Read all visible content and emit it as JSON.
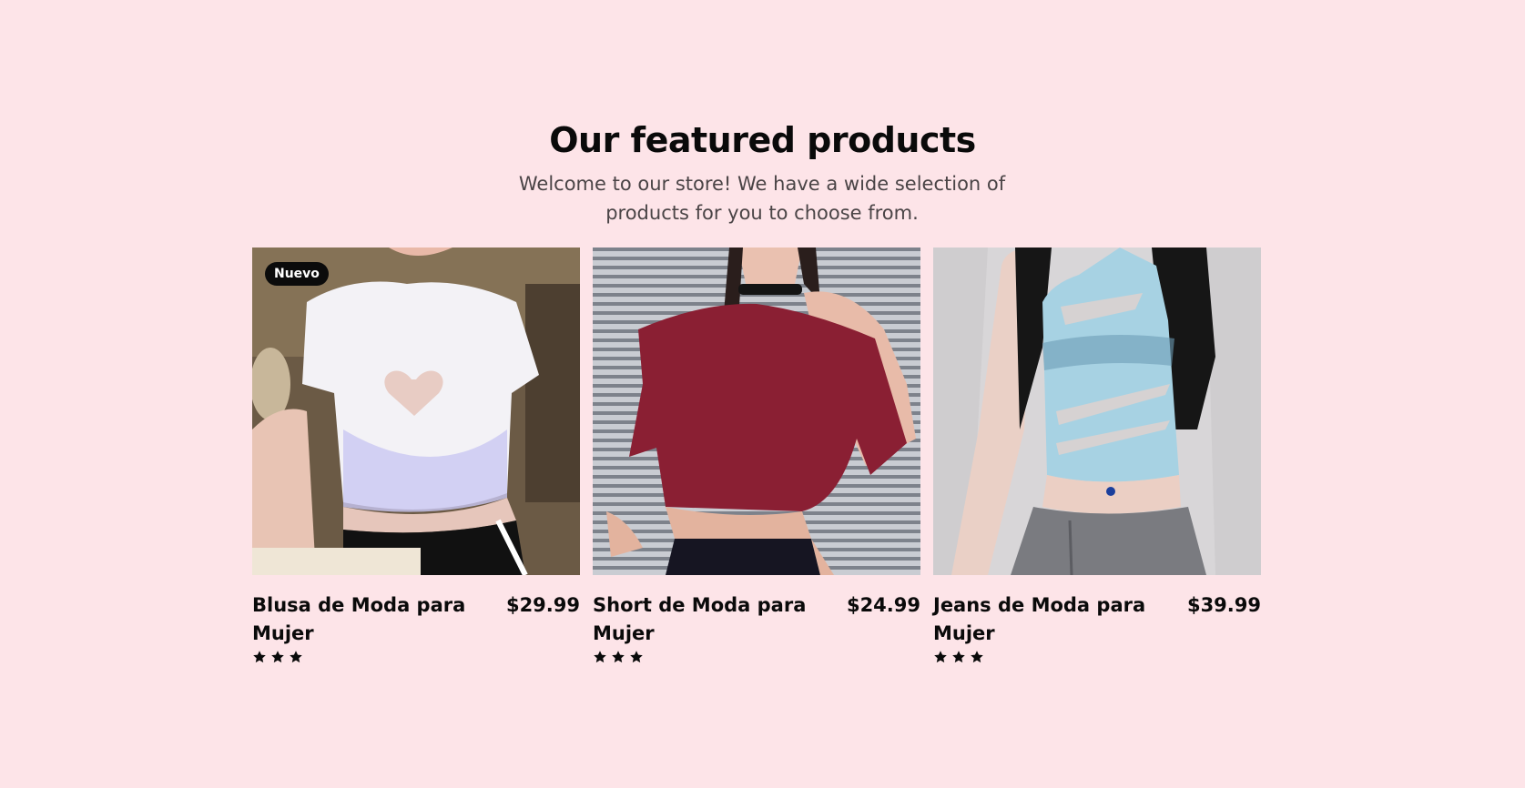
{
  "section": {
    "title": "Our featured products",
    "subtitle": "Welcome to our store! We have a wide selection of products for you to choose from."
  },
  "products": [
    {
      "name": "Blusa de Moda para Mujer",
      "price": "$29.99",
      "badge": "Nuevo",
      "rating": 3,
      "image": "white-heart-cutout-crop-top"
    },
    {
      "name": "Short de Moda para Mujer",
      "price": "$24.99",
      "badge": "",
      "rating": 3,
      "image": "burgundy-off-shoulder-crop-top"
    },
    {
      "name": "Jeans de Moda para Mujer",
      "price": "$39.99",
      "badge": "",
      "rating": 3,
      "image": "light-blue-ripped-tank-top"
    }
  ],
  "colors": {
    "background": "#fde4e8",
    "text": "#0a0a0a",
    "subtitle": "#4a4446",
    "badge_bg": "#0b0b0b",
    "badge_text": "#ffffff",
    "star": "#0a0a0a"
  }
}
